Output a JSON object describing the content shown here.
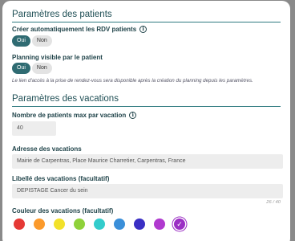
{
  "patients": {
    "title": "Paramètres des patients",
    "auto_create": {
      "label": "Créer automatiquement les RDV patients",
      "yes": "Oui",
      "no": "Non",
      "selected": "yes"
    },
    "planning_visible": {
      "label": "Planning visible par le patient",
      "yes": "Oui",
      "no": "Non",
      "selected": "yes"
    },
    "note": "Le lien d'accès à la prise de rendez-vous sera disponible après la création du planning depuis les paramètres."
  },
  "vacations": {
    "title": "Paramètres des vacations",
    "max_patients": {
      "label": "Nombre de patients max par vacation",
      "value": "40"
    },
    "address": {
      "label": "Adresse des vacations",
      "value": "Mairie de Carpentras, Place Maurice Charretier, Carpentras, France"
    },
    "libelle": {
      "label": "Libellé des vacations (facultatif)",
      "value": "DEPISTAGE Cancer du sein",
      "counter": "26 / 40"
    },
    "colors": {
      "label": "Couleur des vacations (facultatif)",
      "options": [
        {
          "name": "red",
          "hex": "#e53935"
        },
        {
          "name": "orange",
          "hex": "#fb9a2c"
        },
        {
          "name": "yellow",
          "hex": "#f2e12a"
        },
        {
          "name": "green",
          "hex": "#8fd13a"
        },
        {
          "name": "teal",
          "hex": "#33cccc"
        },
        {
          "name": "blue",
          "hex": "#3a8fd9"
        },
        {
          "name": "indigo",
          "hex": "#3a2fc4"
        },
        {
          "name": "purple",
          "hex": "#b03acf"
        },
        {
          "name": "magenta",
          "hex": "#9b2fc4"
        }
      ],
      "selected_index": 8,
      "check_glyph": "✓"
    }
  }
}
